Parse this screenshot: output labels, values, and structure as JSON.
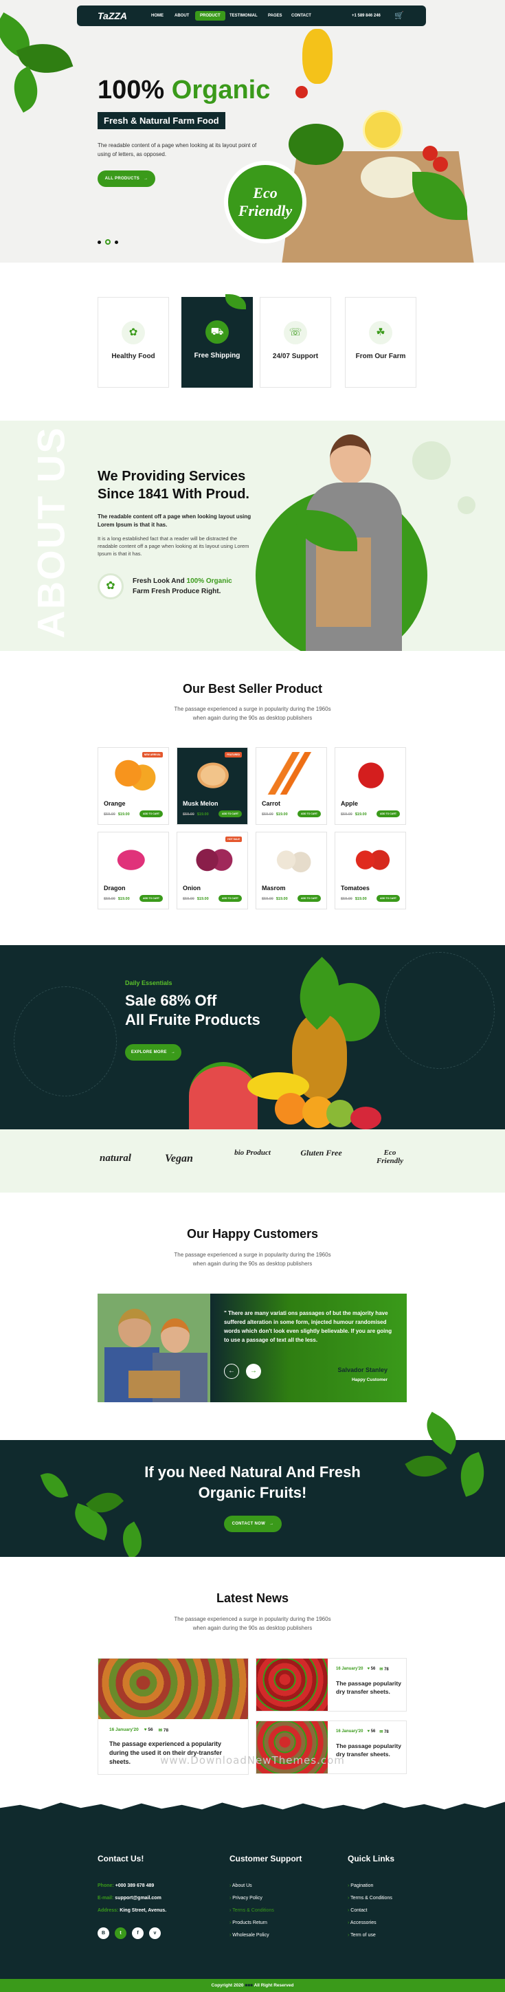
{
  "nav": {
    "logo": "TaZZA",
    "items": [
      "HOME",
      "ABOUT",
      "PRODUCT",
      "TESTIMONIAL",
      "PAGES",
      "CONTACT"
    ],
    "active": 2,
    "phone": "+1 589 846 246"
  },
  "hero": {
    "title_a": "100%",
    "title_b": "Organic",
    "subtitle": "Fresh & Natural Farm Food",
    "desc": "The readable content of a page when looking at its layout point of using of letters, as opposed.",
    "button": "ALL PRODUCTS",
    "badge_top": "Eco",
    "badge_bottom": "Friendly"
  },
  "features": [
    {
      "label": "Healthy Food",
      "icon": "apple-icon"
    },
    {
      "label": "Free Shipping",
      "icon": "truck-icon"
    },
    {
      "label": "24/07 Support",
      "icon": "support-icon"
    },
    {
      "label": "From Our Farm",
      "icon": "farm-icon"
    }
  ],
  "about": {
    "watermark": "ABOUT US",
    "title": "We Providing Services Since 1841 With Proud.",
    "lead": "The readable content off a page when looking layout using Lorem Ipsum is that it has.",
    "body": "It is a long established fact that a reader will be distracted the readable content off a page when looking at its layout using Lorem Ipsum is that it has.",
    "highlight_a": "Fresh Look And",
    "highlight_b": "100% Organic",
    "highlight_c": "Farm Fresh Produce Right."
  },
  "products": {
    "title": "Our Best Seller Product",
    "sub": "The passage experienced a surge in popularity during the 1960s when again during the 90s as desktop publishers",
    "add": "ADD TO CART",
    "items": [
      {
        "name": "Orange",
        "old": "$59.00",
        "price": "$19.00",
        "badge": "NEW ARRIVAL"
      },
      {
        "name": "Musk Melon",
        "old": "$59.00",
        "price": "$19.00",
        "badge": "FEATURED"
      },
      {
        "name": "Carrot",
        "old": "$59.00",
        "price": "$19.00",
        "badge": ""
      },
      {
        "name": "Apple",
        "old": "$59.00",
        "price": "$19.00",
        "badge": ""
      },
      {
        "name": "Dragon",
        "old": "$59.00",
        "price": "$19.00",
        "badge": ""
      },
      {
        "name": "Onion",
        "old": "$59.00",
        "price": "$19.00",
        "badge": "HOT SALE"
      },
      {
        "name": "Masrom",
        "old": "$59.00",
        "price": "$19.00",
        "badge": ""
      },
      {
        "name": "Tomatoes",
        "old": "$59.00",
        "price": "$19.00",
        "badge": ""
      }
    ]
  },
  "promo": {
    "kicker": "Daily Essentials",
    "title_a": "Sale 68% Off",
    "title_b": "All Fruite Products",
    "button": "EXPLORE MORE"
  },
  "brands": [
    "natural",
    "Vegan",
    "bio Product",
    "Gluten Free",
    "Eco Friendly"
  ],
  "testimonial": {
    "title": "Our Happy Customers",
    "sub": "The passage experienced a surge in popularity during the 1960s when again during the 90s as desktop publishers",
    "quote": "\" There are many variati ons passages of but the majority have suffered alteration in some form, injected humour randomised words which don't look even slightly believable. If you are going to use a passage of text all the less.",
    "name": "Salvador Stanley",
    "role": "Happy Customer"
  },
  "cta": {
    "title_a": "If you Need Natural And Fresh",
    "title_b": "Organic Fruits!",
    "button": "CONTACT NOW"
  },
  "news": {
    "title": "Latest News",
    "sub": "The passage experienced a surge in popularity during the 1960s when again during the 90s as desktop publishers",
    "date": "16 January'20",
    "likes": "56",
    "comments": "78",
    "big": "The passage experienced a popularity during the used it on their dry-transfer sheets.",
    "small": "The passage popularity dry transfer sheets."
  },
  "watermark": "www.DownloadNewThemes.com",
  "footer": {
    "contact_title": "Contact Us!",
    "phone_l": "Phone:",
    "phone": "+000 389 678 489",
    "email_l": "E-mail:",
    "email": "support@gmail.com",
    "addr_l": "Address:",
    "addr": "King Street, Avenus.",
    "support_title": "Customer Support",
    "support": [
      "About Us",
      "Privacy Policy",
      "Terms & Conditions",
      "Products Return",
      "Wholesale Policy"
    ],
    "links_title": "Quick Links",
    "links": [
      "Pagination",
      "Terms & Conditions",
      "Contact",
      "Accessories",
      "Term of use"
    ],
    "copy_a": "Copyright 2020",
    "copy_b": "All Right Reserved"
  },
  "colors": {
    "green": "#3a9a1a",
    "dark": "#102a2d",
    "light": "#eef6ea"
  }
}
